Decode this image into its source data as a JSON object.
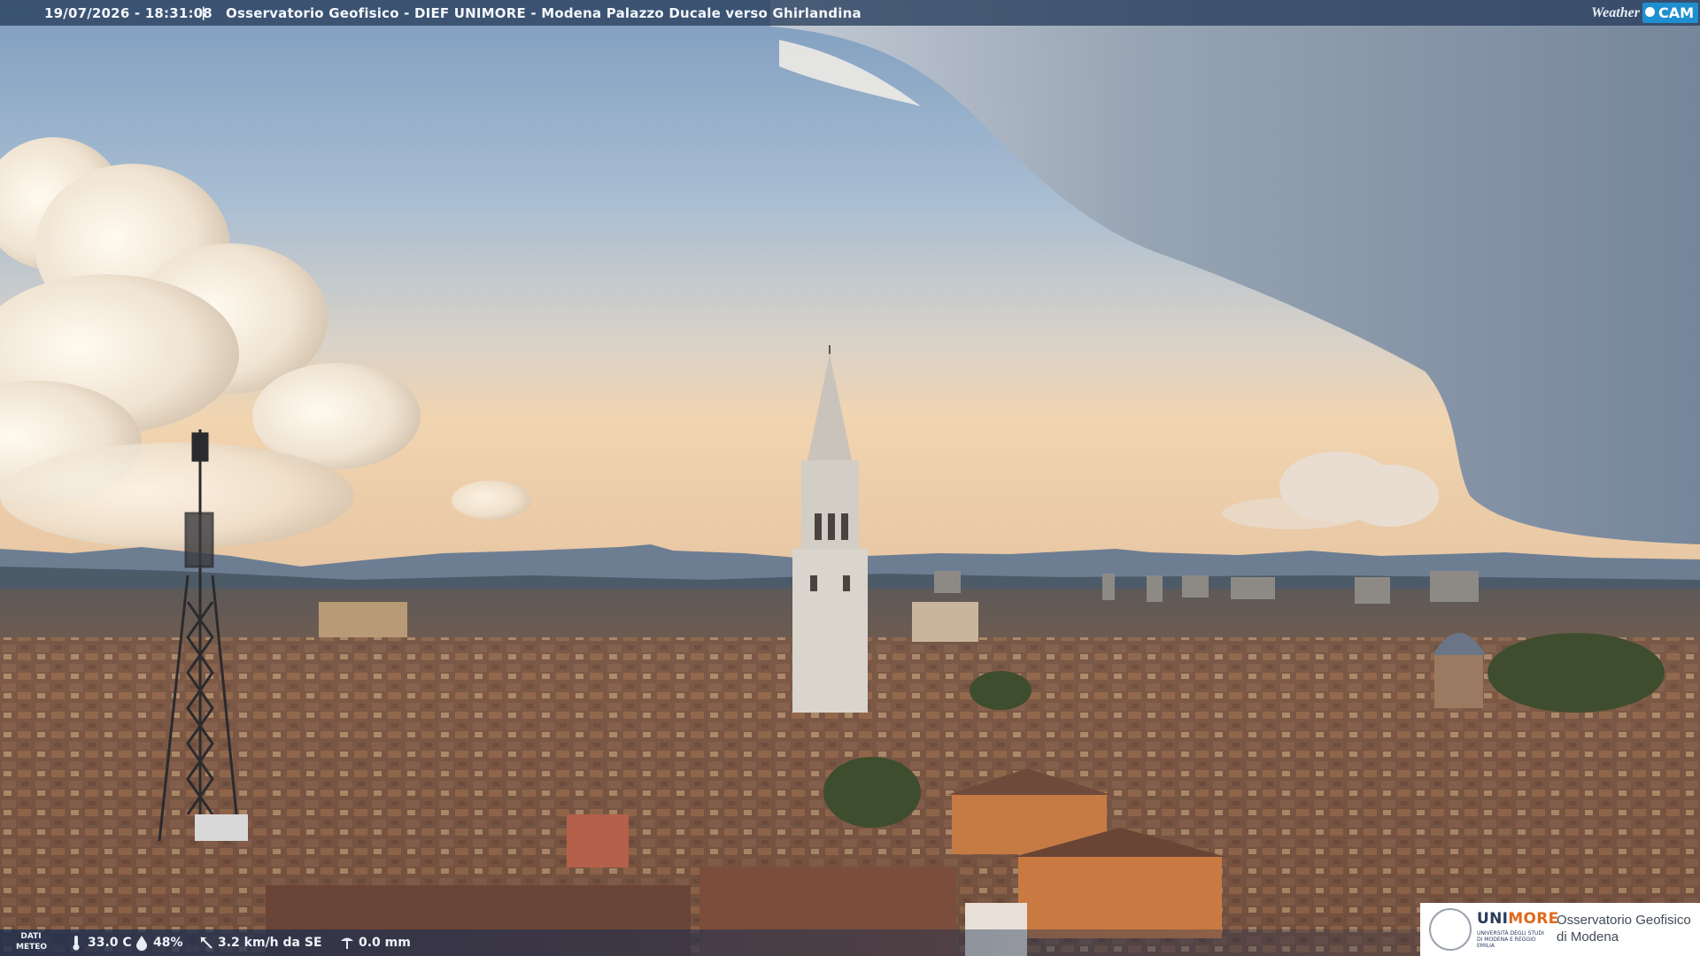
{
  "header": {
    "timestamp": "19/07/2026 - 18:31:08",
    "separator": "|",
    "title": "Osservatorio Geofisico - DIEF UNIMORE - Modena Palazzo Ducale verso Ghirlandina"
  },
  "brand": {
    "part1": "Weather",
    "part2": "CAM",
    "accent": "#1f8fd1"
  },
  "meteo": {
    "label_line1": "DATI",
    "label_line2": "METEO",
    "temperature": "33.0 C",
    "humidity": "48%",
    "wind": "3.2 km/h da SE",
    "rain": "0.0 mm"
  },
  "logo": {
    "uni_part1": "UNI",
    "uni_part2": "MORE",
    "uni_sub": "UNIVERSITÀ DEGLI STUDI DI MODENA E REGGIO EMILIA",
    "obs_line1": "Osservatorio Geofisico",
    "obs_line2": "di Modena"
  },
  "colors": {
    "sky_top": "#8aa6c4",
    "sky_horizon": "#f1d5b2",
    "roofs": "#7a5a48",
    "uni_blue": "#2a3a5c",
    "uni_orange": "#e0691c"
  }
}
